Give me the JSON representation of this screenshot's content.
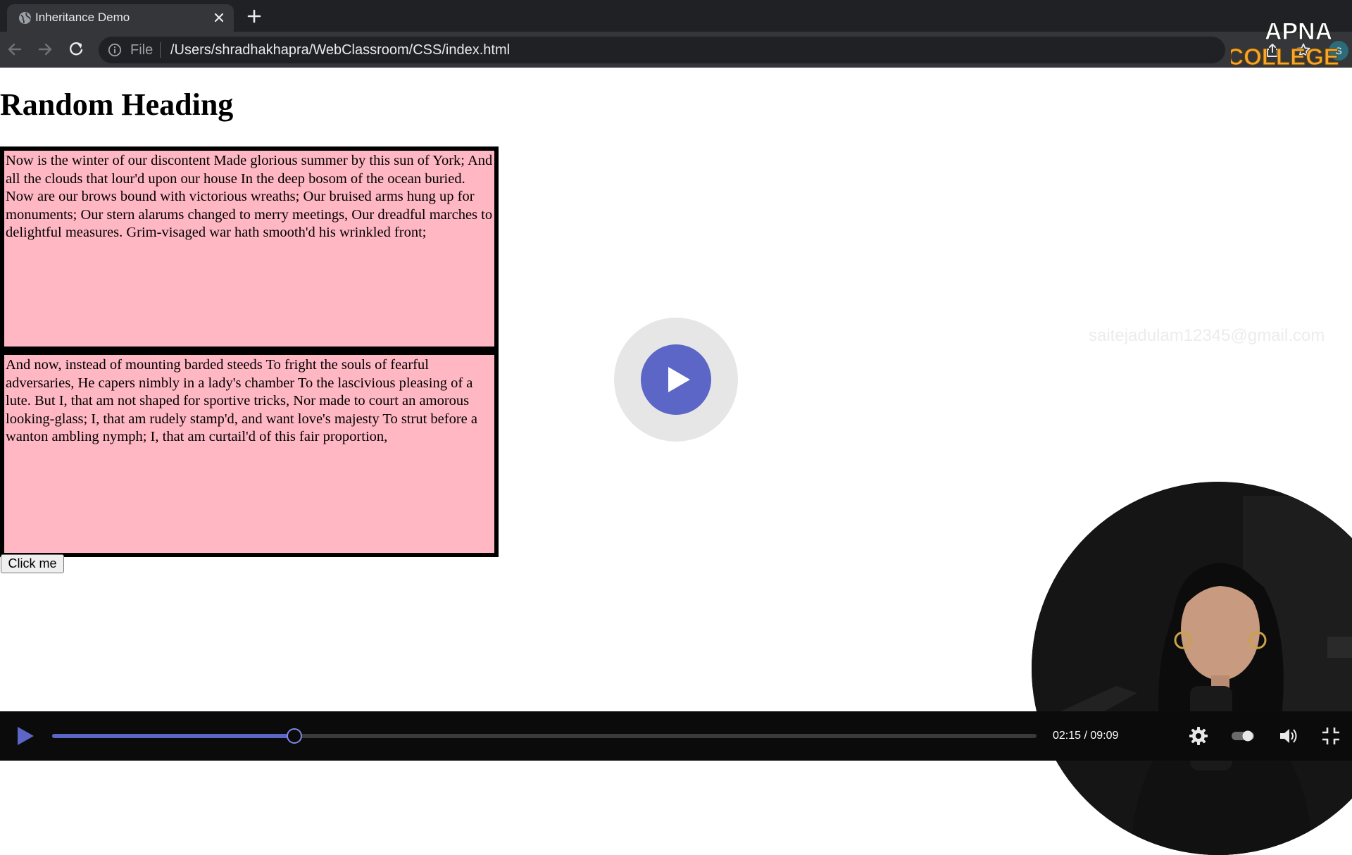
{
  "browser": {
    "tab_title": "Inheritance Demo",
    "address_prefix": "File",
    "url": "/Users/shradhakhapra/WebClassroom/CSS/index.html",
    "profile_initial": "S"
  },
  "page": {
    "heading": "Random Heading",
    "paragraphs": [
      "Now is the winter of our discontent Made glorious summer by this sun of York; And all the clouds that lour'd upon our house In the deep bosom of the ocean buried. Now are our brows bound with victorious wreaths; Our bruised arms hung up for monuments; Our stern alarums changed to merry meetings, Our dreadful marches to delightful measures. Grim-visaged war hath smooth'd his wrinkled front;",
      "And now, instead of mounting barded steeds To fright the souls of fearful adversaries, He capers nimbly in a lady's chamber To the lascivious pleasing of a lute. But I, that am not shaped for sportive tricks, Nor made to court an amorous looking-glass; I, that am rudely stamp'd, and want love's majesty To strut before a wanton ambling nymph; I, that am curtail'd of this fair proportion,"
    ],
    "button_label": "Click me"
  },
  "overlay": {
    "watermark": "saitejadulam12345@gmail.com",
    "brand_line1": "APNA",
    "brand_line2": "COLLEGE"
  },
  "player": {
    "time": "02:15 / 09:09",
    "progress_fraction": 0.2463
  },
  "colors": {
    "paragraph_background": "#ffb7c3",
    "accent": "#5b66c6",
    "brand_orange": "#f4a72a"
  },
  "icons": [
    "globe-icon",
    "close-icon",
    "plus-icon",
    "back-arrow-icon",
    "forward-arrow-icon",
    "reload-icon",
    "info-icon",
    "share-icon",
    "star-icon",
    "play-icon",
    "settings-gear-icon",
    "toggle-icon",
    "volume-icon",
    "exit-fullscreen-icon"
  ]
}
